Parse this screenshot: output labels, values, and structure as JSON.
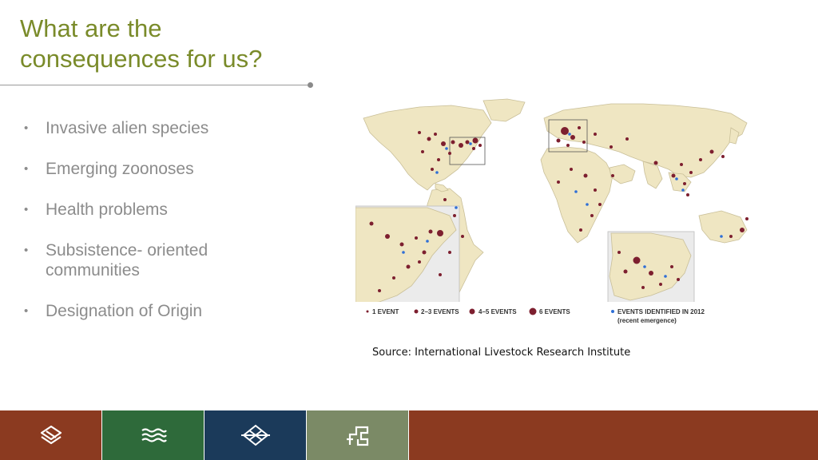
{
  "slide": {
    "title_line1": "What are the",
    "title_line2": "consequences for us?"
  },
  "bullets": [
    {
      "text": "Invasive alien species"
    },
    {
      "text": "Emerging zoonoses"
    },
    {
      "text": "Health problems"
    },
    {
      "text": "Subsistence- oriented communities"
    },
    {
      "text": "Designation of Origin"
    }
  ],
  "map": {
    "legend": {
      "one_event": "1 EVENT",
      "two_three": "2–3 EVENTS",
      "four_five": "4–5 EVENTS",
      "six": "6 EVENTS",
      "identified_2012": "EVENTS IDENTIFIED IN 2012",
      "recent": "(recent emergence)"
    }
  },
  "source_text": "Source: International Livestock Research Institute",
  "colors": {
    "title": "#7a8b2a",
    "land": "#efe6c2",
    "event": "#7d1f2f",
    "recent": "#2f6fd6",
    "footer_rust": "#8b3a20",
    "footer_green": "#2e6a3a",
    "footer_navy": "#1b3a5a",
    "footer_sage": "#7b8a66"
  },
  "footer": {
    "tiles": [
      {
        "icon": "layers-chevron-icon"
      },
      {
        "icon": "waves-icon"
      },
      {
        "icon": "diamond-weave-icon"
      },
      {
        "icon": "maze-icon"
      }
    ]
  }
}
